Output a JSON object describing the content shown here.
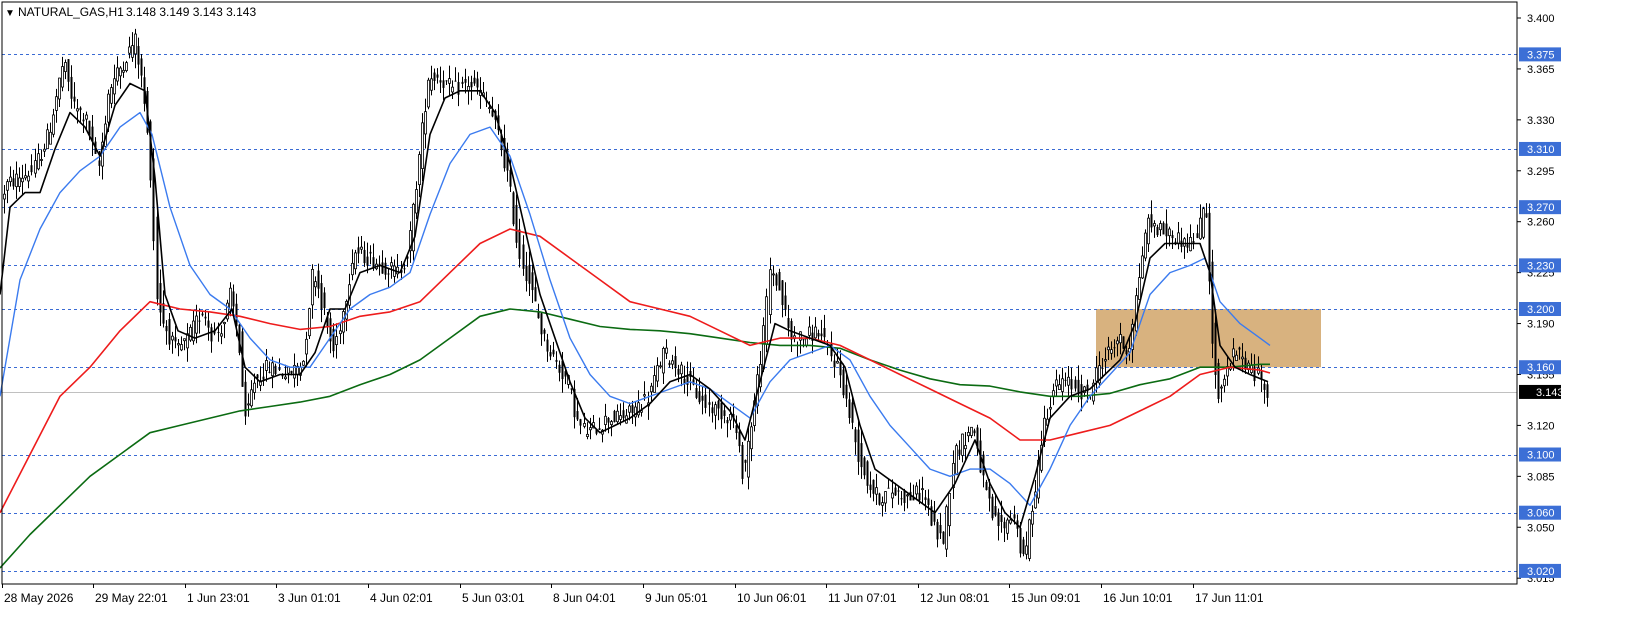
{
  "header": {
    "arrow": "▼",
    "symbol": "NATURAL_GAS,H1",
    "ohlc": "3.148 3.149 3.143 3.143"
  },
  "colors": {
    "level_line": "#3a6bd4",
    "level_label_bg": "#3c6fd6",
    "current_label_bg": "#000000",
    "zone": "#d8b27f",
    "ma_fast": "#000000",
    "ma_mid": "#3b7bef",
    "ma_slow": "#ee1c1c",
    "ma_long": "#0b6b12"
  },
  "chart_data": {
    "type": "candlestick",
    "ylim": [
      3.011,
      3.411
    ],
    "price_ticks": [
      "3.400",
      "3.365",
      "3.330",
      "3.295",
      "3.260",
      "3.225",
      "3.190",
      "3.155",
      "3.120",
      "3.085",
      "3.050",
      "3.015"
    ],
    "price_tick_values": [
      3.4,
      3.365,
      3.33,
      3.295,
      3.26,
      3.225,
      3.19,
      3.155,
      3.12,
      3.085,
      3.05,
      3.015
    ],
    "levels": [
      "3.375",
      "3.310",
      "3.270",
      "3.230",
      "3.200",
      "3.160",
      "3.100",
      "3.060",
      "3.020"
    ],
    "level_values": [
      3.375,
      3.31,
      3.27,
      3.23,
      3.2,
      3.16,
      3.1,
      3.06,
      3.02
    ],
    "current_price": "3.143",
    "current_price_value": 3.143,
    "zone": {
      "from_label": "16 Jun 10:01",
      "to_label": "17 Jun 11:01",
      "low": 3.16,
      "high": 3.2
    },
    "time_labels": [
      "28 May 2026",
      "29 May 22:01",
      "1 Jun 23:01",
      "3 Jun 01:01",
      "4 Jun 02:01",
      "5 Jun 03:01",
      "8 Jun 04:01",
      "9 Jun 05:01",
      "10 Jun 06:01",
      "11 Jun 07:01",
      "12 Jun 08:01",
      "15 Jun 09:01",
      "16 Jun 10:01",
      "17 Jun 11:01"
    ],
    "price_path": [
      [
        0,
        3.27
      ],
      [
        8,
        3.285
      ],
      [
        20,
        3.29
      ],
      [
        35,
        3.295
      ],
      [
        50,
        3.32
      ],
      [
        65,
        3.37
      ],
      [
        75,
        3.34
      ],
      [
        88,
        3.33
      ],
      [
        100,
        3.295
      ],
      [
        110,
        3.35
      ],
      [
        125,
        3.37
      ],
      [
        137,
        3.385
      ],
      [
        145,
        3.35
      ],
      [
        152,
        3.3
      ],
      [
        158,
        3.21
      ],
      [
        165,
        3.19
      ],
      [
        178,
        3.17
      ],
      [
        190,
        3.18
      ],
      [
        205,
        3.2
      ],
      [
        215,
        3.18
      ],
      [
        225,
        3.19
      ],
      [
        232,
        3.21
      ],
      [
        240,
        3.18
      ],
      [
        247,
        3.12
      ],
      [
        255,
        3.15
      ],
      [
        270,
        3.16
      ],
      [
        290,
        3.155
      ],
      [
        305,
        3.165
      ],
      [
        315,
        3.23
      ],
      [
        325,
        3.2
      ],
      [
        335,
        3.17
      ],
      [
        345,
        3.2
      ],
      [
        355,
        3.24
      ],
      [
        370,
        3.235
      ],
      [
        385,
        3.23
      ],
      [
        400,
        3.225
      ],
      [
        410,
        3.24
      ],
      [
        420,
        3.3
      ],
      [
        430,
        3.36
      ],
      [
        440,
        3.36
      ],
      [
        455,
        3.35
      ],
      [
        470,
        3.355
      ],
      [
        480,
        3.35
      ],
      [
        490,
        3.34
      ],
      [
        500,
        3.32
      ],
      [
        510,
        3.29
      ],
      [
        520,
        3.24
      ],
      [
        530,
        3.22
      ],
      [
        545,
        3.18
      ],
      [
        560,
        3.16
      ],
      [
        570,
        3.15
      ],
      [
        580,
        3.12
      ],
      [
        590,
        3.115
      ],
      [
        600,
        3.12
      ],
      [
        610,
        3.125
      ],
      [
        622,
        3.125
      ],
      [
        635,
        3.13
      ],
      [
        650,
        3.14
      ],
      [
        665,
        3.17
      ],
      [
        680,
        3.16
      ],
      [
        690,
        3.15
      ],
      [
        705,
        3.135
      ],
      [
        720,
        3.13
      ],
      [
        735,
        3.125
      ],
      [
        745,
        3.085
      ],
      [
        755,
        3.13
      ],
      [
        765,
        3.18
      ],
      [
        772,
        3.23
      ],
      [
        782,
        3.21
      ],
      [
        792,
        3.18
      ],
      [
        805,
        3.18
      ],
      [
        820,
        3.185
      ],
      [
        830,
        3.17
      ],
      [
        840,
        3.16
      ],
      [
        850,
        3.13
      ],
      [
        860,
        3.1
      ],
      [
        870,
        3.08
      ],
      [
        880,
        3.07
      ],
      [
        895,
        3.075
      ],
      [
        910,
        3.07
      ],
      [
        925,
        3.075
      ],
      [
        935,
        3.05
      ],
      [
        945,
        3.04
      ],
      [
        955,
        3.1
      ],
      [
        965,
        3.11
      ],
      [
        975,
        3.12
      ],
      [
        985,
        3.08
      ],
      [
        995,
        3.055
      ],
      [
        1005,
        3.05
      ],
      [
        1015,
        3.06
      ],
      [
        1025,
        3.025
      ],
      [
        1035,
        3.07
      ],
      [
        1045,
        3.12
      ],
      [
        1055,
        3.145
      ],
      [
        1065,
        3.15
      ],
      [
        1080,
        3.145
      ],
      [
        1090,
        3.14
      ],
      [
        1100,
        3.16
      ],
      [
        1110,
        3.17
      ],
      [
        1120,
        3.18
      ],
      [
        1130,
        3.17
      ],
      [
        1138,
        3.21
      ],
      [
        1148,
        3.26
      ],
      [
        1160,
        3.255
      ],
      [
        1175,
        3.25
      ],
      [
        1190,
        3.245
      ],
      [
        1200,
        3.25
      ],
      [
        1206,
        3.28
      ],
      [
        1212,
        3.2
      ],
      [
        1218,
        3.14
      ],
      [
        1225,
        3.15
      ],
      [
        1232,
        3.165
      ],
      [
        1240,
        3.17
      ],
      [
        1250,
        3.16
      ],
      [
        1258,
        3.155
      ],
      [
        1265,
        3.15
      ],
      [
        1270,
        3.143
      ]
    ],
    "ma_fast_path": [
      [
        0,
        3.21
      ],
      [
        10,
        3.27
      ],
      [
        25,
        3.28
      ],
      [
        40,
        3.28
      ],
      [
        55,
        3.31
      ],
      [
        70,
        3.335
      ],
      [
        85,
        3.325
      ],
      [
        100,
        3.305
      ],
      [
        115,
        3.34
      ],
      [
        130,
        3.355
      ],
      [
        145,
        3.35
      ],
      [
        155,
        3.29
      ],
      [
        165,
        3.21
      ],
      [
        178,
        3.185
      ],
      [
        195,
        3.18
      ],
      [
        215,
        3.185
      ],
      [
        232,
        3.2
      ],
      [
        245,
        3.16
      ],
      [
        260,
        3.15
      ],
      [
        280,
        3.155
      ],
      [
        300,
        3.155
      ],
      [
        315,
        3.17
      ],
      [
        330,
        3.2
      ],
      [
        345,
        3.2
      ],
      [
        360,
        3.225
      ],
      [
        380,
        3.23
      ],
      [
        400,
        3.225
      ],
      [
        415,
        3.25
      ],
      [
        430,
        3.32
      ],
      [
        445,
        3.345
      ],
      [
        460,
        3.35
      ],
      [
        480,
        3.35
      ],
      [
        495,
        3.335
      ],
      [
        510,
        3.3
      ],
      [
        525,
        3.255
      ],
      [
        540,
        3.21
      ],
      [
        555,
        3.18
      ],
      [
        570,
        3.15
      ],
      [
        585,
        3.125
      ],
      [
        600,
        3.115
      ],
      [
        615,
        3.12
      ],
      [
        630,
        3.125
      ],
      [
        650,
        3.135
      ],
      [
        670,
        3.15
      ],
      [
        690,
        3.155
      ],
      [
        710,
        3.145
      ],
      [
        730,
        3.13
      ],
      [
        745,
        3.11
      ],
      [
        760,
        3.15
      ],
      [
        775,
        3.19
      ],
      [
        790,
        3.185
      ],
      [
        810,
        3.18
      ],
      [
        830,
        3.175
      ],
      [
        845,
        3.16
      ],
      [
        860,
        3.12
      ],
      [
        875,
        3.09
      ],
      [
        895,
        3.08
      ],
      [
        915,
        3.07
      ],
      [
        935,
        3.06
      ],
      [
        955,
        3.08
      ],
      [
        975,
        3.11
      ],
      [
        990,
        3.08
      ],
      [
        1005,
        3.06
      ],
      [
        1020,
        3.05
      ],
      [
        1035,
        3.085
      ],
      [
        1050,
        3.125
      ],
      [
        1070,
        3.14
      ],
      [
        1090,
        3.145
      ],
      [
        1105,
        3.155
      ],
      [
        1120,
        3.165
      ],
      [
        1135,
        3.19
      ],
      [
        1150,
        3.235
      ],
      [
        1165,
        3.245
      ],
      [
        1185,
        3.245
      ],
      [
        1200,
        3.245
      ],
      [
        1210,
        3.225
      ],
      [
        1220,
        3.175
      ],
      [
        1235,
        3.16
      ],
      [
        1250,
        3.155
      ],
      [
        1268,
        3.15
      ]
    ],
    "ma_mid_path": [
      [
        0,
        3.14
      ],
      [
        20,
        3.22
      ],
      [
        40,
        3.255
      ],
      [
        60,
        3.28
      ],
      [
        80,
        3.295
      ],
      [
        100,
        3.305
      ],
      [
        120,
        3.325
      ],
      [
        140,
        3.335
      ],
      [
        152,
        3.32
      ],
      [
        170,
        3.27
      ],
      [
        190,
        3.23
      ],
      [
        210,
        3.21
      ],
      [
        230,
        3.2
      ],
      [
        250,
        3.18
      ],
      [
        270,
        3.165
      ],
      [
        290,
        3.16
      ],
      [
        310,
        3.16
      ],
      [
        330,
        3.18
      ],
      [
        350,
        3.2
      ],
      [
        370,
        3.21
      ],
      [
        390,
        3.215
      ],
      [
        410,
        3.225
      ],
      [
        430,
        3.265
      ],
      [
        450,
        3.3
      ],
      [
        470,
        3.32
      ],
      [
        490,
        3.325
      ],
      [
        510,
        3.305
      ],
      [
        530,
        3.265
      ],
      [
        550,
        3.22
      ],
      [
        570,
        3.18
      ],
      [
        590,
        3.155
      ],
      [
        610,
        3.14
      ],
      [
        630,
        3.135
      ],
      [
        650,
        3.14
      ],
      [
        670,
        3.145
      ],
      [
        690,
        3.15
      ],
      [
        710,
        3.145
      ],
      [
        730,
        3.135
      ],
      [
        750,
        3.125
      ],
      [
        770,
        3.15
      ],
      [
        790,
        3.165
      ],
      [
        810,
        3.17
      ],
      [
        830,
        3.175
      ],
      [
        850,
        3.165
      ],
      [
        870,
        3.14
      ],
      [
        890,
        3.12
      ],
      [
        910,
        3.105
      ],
      [
        930,
        3.09
      ],
      [
        950,
        3.085
      ],
      [
        970,
        3.09
      ],
      [
        990,
        3.09
      ],
      [
        1010,
        3.08
      ],
      [
        1030,
        3.065
      ],
      [
        1050,
        3.09
      ],
      [
        1070,
        3.12
      ],
      [
        1090,
        3.14
      ],
      [
        1110,
        3.155
      ],
      [
        1130,
        3.17
      ],
      [
        1150,
        3.21
      ],
      [
        1170,
        3.225
      ],
      [
        1190,
        3.23
      ],
      [
        1205,
        3.235
      ],
      [
        1220,
        3.205
      ],
      [
        1240,
        3.19
      ],
      [
        1260,
        3.18
      ],
      [
        1270,
        3.175
      ]
    ],
    "ma_slow_path": [
      [
        0,
        3.06
      ],
      [
        30,
        3.1
      ],
      [
        60,
        3.14
      ],
      [
        90,
        3.16
      ],
      [
        120,
        3.185
      ],
      [
        150,
        3.205
      ],
      [
        180,
        3.2
      ],
      [
        210,
        3.198
      ],
      [
        240,
        3.195
      ],
      [
        270,
        3.19
      ],
      [
        300,
        3.186
      ],
      [
        330,
        3.188
      ],
      [
        360,
        3.195
      ],
      [
        390,
        3.198
      ],
      [
        420,
        3.205
      ],
      [
        450,
        3.225
      ],
      [
        480,
        3.245
      ],
      [
        510,
        3.255
      ],
      [
        540,
        3.25
      ],
      [
        570,
        3.235
      ],
      [
        600,
        3.22
      ],
      [
        630,
        3.205
      ],
      [
        660,
        3.2
      ],
      [
        690,
        3.195
      ],
      [
        720,
        3.185
      ],
      [
        750,
        3.175
      ],
      [
        780,
        3.18
      ],
      [
        810,
        3.18
      ],
      [
        840,
        3.175
      ],
      [
        870,
        3.165
      ],
      [
        900,
        3.155
      ],
      [
        930,
        3.145
      ],
      [
        960,
        3.135
      ],
      [
        990,
        3.125
      ],
      [
        1020,
        3.11
      ],
      [
        1050,
        3.11
      ],
      [
        1080,
        3.115
      ],
      [
        1110,
        3.12
      ],
      [
        1140,
        3.13
      ],
      [
        1170,
        3.14
      ],
      [
        1200,
        3.155
      ],
      [
        1230,
        3.16
      ],
      [
        1260,
        3.158
      ],
      [
        1270,
        3.156
      ]
    ],
    "ma_long_path": [
      [
        0,
        3.022
      ],
      [
        30,
        3.045
      ],
      [
        60,
        3.065
      ],
      [
        90,
        3.085
      ],
      [
        120,
        3.1
      ],
      [
        150,
        3.115
      ],
      [
        180,
        3.12
      ],
      [
        210,
        3.125
      ],
      [
        240,
        3.13
      ],
      [
        270,
        3.133
      ],
      [
        300,
        3.136
      ],
      [
        330,
        3.14
      ],
      [
        360,
        3.148
      ],
      [
        390,
        3.155
      ],
      [
        420,
        3.165
      ],
      [
        450,
        3.18
      ],
      [
        480,
        3.195
      ],
      [
        510,
        3.2
      ],
      [
        540,
        3.198
      ],
      [
        570,
        3.193
      ],
      [
        600,
        3.188
      ],
      [
        630,
        3.186
      ],
      [
        660,
        3.185
      ],
      [
        690,
        3.183
      ],
      [
        720,
        3.18
      ],
      [
        750,
        3.177
      ],
      [
        780,
        3.175
      ],
      [
        810,
        3.175
      ],
      [
        840,
        3.173
      ],
      [
        870,
        3.165
      ],
      [
        900,
        3.158
      ],
      [
        930,
        3.152
      ],
      [
        960,
        3.148
      ],
      [
        990,
        3.147
      ],
      [
        1020,
        3.143
      ],
      [
        1050,
        3.14
      ],
      [
        1080,
        3.14
      ],
      [
        1110,
        3.142
      ],
      [
        1140,
        3.148
      ],
      [
        1170,
        3.152
      ],
      [
        1200,
        3.16
      ],
      [
        1230,
        3.16
      ],
      [
        1260,
        3.162
      ],
      [
        1270,
        3.162
      ]
    ]
  }
}
